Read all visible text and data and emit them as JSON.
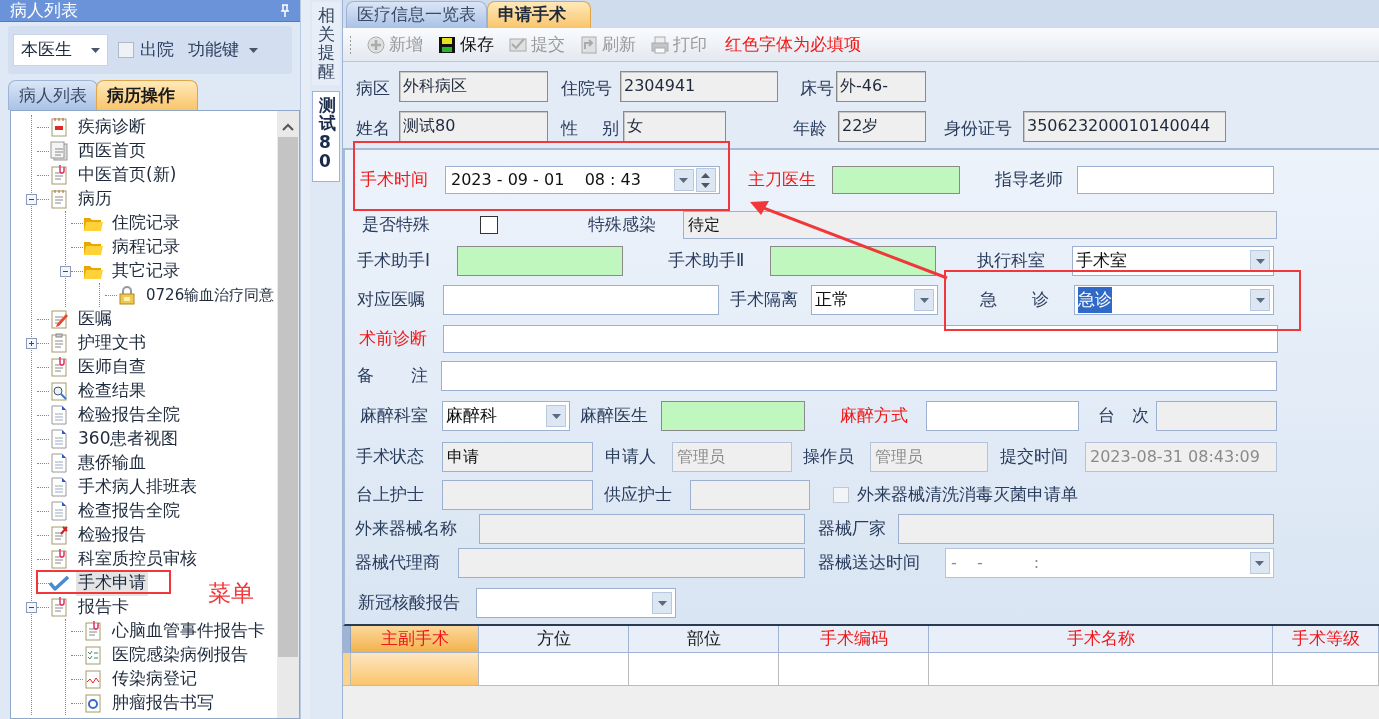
{
  "left_panel": {
    "title": "病人列表",
    "filter": {
      "value": "本医生"
    },
    "discharged": {
      "label": "出院",
      "checked": false
    },
    "function_menu": "功能键",
    "tabs": [
      {
        "label": "病人列表",
        "selected": false
      },
      {
        "label": "病历操作",
        "selected": true
      }
    ],
    "tree": [
      {
        "label": "疾病诊断",
        "kind": "calendar",
        "selected": false
      },
      {
        "label": "西医首页",
        "kind": "pages",
        "selected": false
      },
      {
        "label": "中医首页(新)",
        "kind": "clip",
        "selected": false
      },
      {
        "label": "病历",
        "kind": "notebook",
        "selected": false,
        "expanded": true,
        "children": [
          {
            "label": "住院记录",
            "kind": "folder",
            "selected": false
          },
          {
            "label": "病程记录",
            "kind": "folder",
            "selected": false
          },
          {
            "label": "其它记录",
            "kind": "folder",
            "selected": false,
            "expanded": true,
            "children": [
              {
                "label": "0726输血治疗同意",
                "kind": "lock",
                "selected": false
              }
            ]
          }
        ]
      },
      {
        "label": "医嘱",
        "kind": "edit",
        "selected": false
      },
      {
        "label": "护理文书",
        "kind": "clipboard",
        "selected": false,
        "expanded": false
      },
      {
        "label": "医师自查",
        "kind": "clip",
        "selected": false
      },
      {
        "label": "检查结果",
        "kind": "search",
        "selected": false
      },
      {
        "label": "检验报告全院",
        "kind": "doc",
        "selected": false
      },
      {
        "label": "360患者视图",
        "kind": "doc",
        "selected": false
      },
      {
        "label": "惠侨输血",
        "kind": "doc",
        "selected": false
      },
      {
        "label": "手术病人排班表",
        "kind": "doc",
        "selected": false
      },
      {
        "label": "检查报告全院",
        "kind": "doc",
        "selected": false
      },
      {
        "label": "检验报告",
        "kind": "pin",
        "selected": false
      },
      {
        "label": "科室质控员审核",
        "kind": "clip",
        "selected": false
      },
      {
        "label": "手术申请",
        "kind": "check",
        "selected": true
      },
      {
        "label": "报告卡",
        "kind": "clip",
        "selected": false,
        "expanded": true,
        "children": [
          {
            "label": "心脑血管事件报告卡",
            "kind": "clip",
            "selected": false
          },
          {
            "label": "医院感染病例报告",
            "kind": "checklist",
            "selected": false
          },
          {
            "label": "传染病登记",
            "kind": "chart",
            "selected": false
          },
          {
            "label": "肿瘤报告书写",
            "kind": "target",
            "selected": false
          }
        ]
      }
    ]
  },
  "side_tabs": [
    {
      "label": "相关提醒",
      "selected": false
    },
    {
      "label": "测试80",
      "selected": true
    }
  ],
  "main": {
    "tabs": [
      {
        "label": "医疗信息一览表",
        "selected": false
      },
      {
        "label": "申请手术",
        "selected": true
      }
    ],
    "toolbar": [
      {
        "label": "新增",
        "kind": "add",
        "disabled": true
      },
      {
        "label": "保存",
        "kind": "save",
        "disabled": false
      },
      {
        "label": "提交",
        "kind": "submit",
        "disabled": true
      },
      {
        "label": "刷新",
        "kind": "refresh",
        "disabled": true
      },
      {
        "label": "打印",
        "kind": "print",
        "disabled": true
      }
    ],
    "toolbar_note": "红色字体为必填项",
    "patient_info": [
      [
        {
          "label": "病区",
          "value": "外科病区"
        },
        {
          "label": "住院号",
          "value": "2304941"
        },
        {
          "label": "床号",
          "value": "外-46-"
        }
      ],
      [
        {
          "label": "姓名",
          "value": "测试80"
        },
        {
          "label": "性 别",
          "value": "女"
        },
        {
          "label": "年龄",
          "value": "22岁"
        },
        {
          "label": "身份证号",
          "value": "350623200010140044"
        }
      ]
    ],
    "form": [
      [
        {
          "kind": "label",
          "text": "手术时间",
          "required": true
        },
        {
          "kind": "datetime",
          "value": "2023 - 09 - 01    08 : 43",
          "disabled": false
        },
        {
          "kind": "label",
          "text": "主刀医生",
          "required": true
        },
        {
          "kind": "picker"
        },
        {
          "kind": "label",
          "text": "指导老师",
          "required": false
        },
        {
          "kind": "field",
          "readonly": false,
          "disabled": false
        }
      ],
      [
        {
          "kind": "label",
          "text": "是否特殊",
          "required": false
        },
        {
          "kind": "checkbox",
          "checked": false,
          "disabled": false
        },
        {
          "kind": "label",
          "text": "特殊感染",
          "required": false
        },
        {
          "kind": "field",
          "value": "待定",
          "readonly": true,
          "disabled": false
        }
      ],
      [
        {
          "kind": "label",
          "text": "手术助手Ⅰ",
          "required": false
        },
        {
          "kind": "picker"
        },
        {
          "kind": "label",
          "text": "手术助手Ⅱ",
          "required": false
        },
        {
          "kind": "picker"
        },
        {
          "kind": "label",
          "text": "执行科室",
          "required": false
        },
        {
          "kind": "combo",
          "value": "手术室",
          "text_selected": false
        }
      ],
      [
        {
          "kind": "label",
          "text": "对应医嘱",
          "required": false
        },
        {
          "kind": "field",
          "readonly": false,
          "disabled": false
        },
        {
          "kind": "label",
          "text": "手术隔离",
          "required": false
        },
        {
          "kind": "combo",
          "value": "正常",
          "text_selected": false
        },
        {
          "kind": "label",
          "text": "急 诊",
          "required": false
        },
        {
          "kind": "combo",
          "value": "急诊",
          "text_selected": true
        }
      ],
      [
        {
          "kind": "label",
          "text": "术前诊断",
          "required": true
        },
        {
          "kind": "field",
          "readonly": false,
          "disabled": false
        }
      ],
      [
        {
          "kind": "label",
          "text": "备 注",
          "required": false
        },
        {
          "kind": "field",
          "readonly": false,
          "disabled": false
        }
      ],
      [
        {
          "kind": "label",
          "text": "麻醉科室",
          "required": false
        },
        {
          "kind": "combo",
          "value": "麻醉科",
          "text_selected": false
        },
        {
          "kind": "label",
          "text": "麻醉医生",
          "required": false
        },
        {
          "kind": "picker"
        },
        {
          "kind": "label",
          "text": "麻醉方式",
          "required": true
        },
        {
          "kind": "field",
          "readonly": false,
          "disabled": false
        },
        {
          "kind": "label",
          "text": "台 次",
          "required": false
        },
        {
          "kind": "field",
          "readonly": true,
          "disabled": false
        }
      ],
      [
        {
          "kind": "label",
          "text": "手术状态",
          "required": false
        },
        {
          "kind": "field",
          "value": "申请",
          "readonly": true,
          "disabled": false
        },
        {
          "kind": "label",
          "text": "申请人",
          "required": false
        },
        {
          "kind": "field",
          "value": "管理员",
          "readonly": true,
          "disabled": true
        },
        {
          "kind": "label",
          "text": "操作员",
          "required": false
        },
        {
          "kind": "field",
          "value": "管理员",
          "readonly": true,
          "disabled": true
        },
        {
          "kind": "label",
          "text": "提交时间",
          "required": false
        },
        {
          "kind": "field",
          "value": "2023-08-31 08:43:09",
          "readonly": true,
          "disabled": true
        }
      ],
      [
        {
          "kind": "label",
          "text": "台上护士",
          "required": false
        },
        {
          "kind": "field",
          "readonly": true,
          "disabled": false
        },
        {
          "kind": "label",
          "text": "供应护士",
          "required": false
        },
        {
          "kind": "field",
          "readonly": true,
          "disabled": false
        },
        {
          "kind": "checkbox",
          "checked": false,
          "disabled": true
        },
        {
          "kind": "label",
          "text": "外来器械清洗消毒灭菌申请单",
          "required": false
        }
      ],
      [
        {
          "kind": "label",
          "text": "外来器械名称",
          "required": false
        },
        {
          "kind": "field",
          "readonly": true,
          "disabled": false
        },
        {
          "kind": "label",
          "text": "器械厂家",
          "required": false
        },
        {
          "kind": "field",
          "readonly": true,
          "disabled": false
        }
      ],
      [
        {
          "kind": "label",
          "text": "器械代理商",
          "required": false
        },
        {
          "kind": "field",
          "readonly": true,
          "disabled": false
        },
        {
          "kind": "label",
          "text": "器械送达时间",
          "required": false
        },
        {
          "kind": "datetime",
          "value": "-    -          :",
          "disabled": true
        }
      ],
      [
        {
          "kind": "label",
          "text": "新冠核酸报告",
          "required": false
        },
        {
          "kind": "combo"
        }
      ]
    ],
    "grid": {
      "columns": [
        {
          "label": "主副手术",
          "required": true,
          "selected": true
        },
        {
          "label": "方位",
          "required": false,
          "selected": false
        },
        {
          "label": "部位",
          "required": false,
          "selected": false
        },
        {
          "label": "手术编码",
          "required": true,
          "selected": false
        },
        {
          "label": "手术名称",
          "required": true,
          "selected": false
        },
        {
          "label": "手术等级",
          "required": true,
          "selected": false
        }
      ],
      "rows": [
        {
          "selected": true
        }
      ]
    }
  },
  "annotations": [
    {
      "kind": "box"
    },
    {
      "kind": "box"
    },
    {
      "kind": "box"
    },
    {
      "kind": "arrow"
    },
    {
      "kind": "note",
      "text": "菜单"
    }
  ]
}
